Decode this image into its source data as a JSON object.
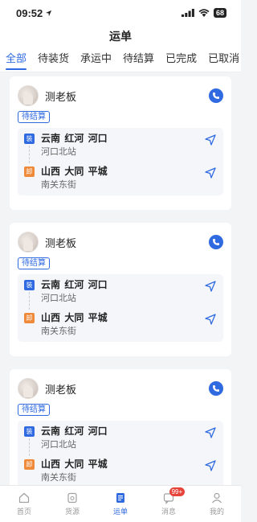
{
  "status_bar": {
    "time": "09:52",
    "battery": "68"
  },
  "header": {
    "title": "运单"
  },
  "tabs": [
    {
      "label": "全部",
      "active": true
    },
    {
      "label": "待装货",
      "active": false
    },
    {
      "label": "承运中",
      "active": false
    },
    {
      "label": "待结算",
      "active": false
    },
    {
      "label": "已完成",
      "active": false
    },
    {
      "label": "已取消",
      "active": false
    }
  ],
  "orders": [
    {
      "name": "测老板",
      "status": "待结算",
      "load": {
        "tag": "装",
        "city": "云南 红河 河口",
        "address": "河口北站"
      },
      "unload": {
        "tag": "卸",
        "city": "山西 大同 平城",
        "address": "南关东街"
      }
    },
    {
      "name": "测老板",
      "status": "待结算",
      "load": {
        "tag": "装",
        "city": "云南 红河 河口",
        "address": "河口北站"
      },
      "unload": {
        "tag": "卸",
        "city": "山西 大同 平城",
        "address": "南关东街"
      }
    },
    {
      "name": "测老板",
      "status": "待结算",
      "load": {
        "tag": "装",
        "city": "云南 红河 河口",
        "address": "河口北站"
      },
      "unload": {
        "tag": "卸",
        "city": "山西 大同 平城",
        "address": "南关东街"
      }
    }
  ],
  "bottom_nav": [
    {
      "label": "首页",
      "icon": "home-icon",
      "active": false
    },
    {
      "label": "货源",
      "icon": "cargo-icon",
      "active": false
    },
    {
      "label": "运单",
      "icon": "waybill-icon",
      "active": true
    },
    {
      "label": "消息",
      "icon": "message-icon",
      "active": false,
      "badge": "99+"
    },
    {
      "label": "我的",
      "icon": "profile-icon",
      "active": false
    }
  ],
  "colors": {
    "accent": "#2f6ae0",
    "unload": "#ef8a3a",
    "badge_red": "#e6433a"
  }
}
